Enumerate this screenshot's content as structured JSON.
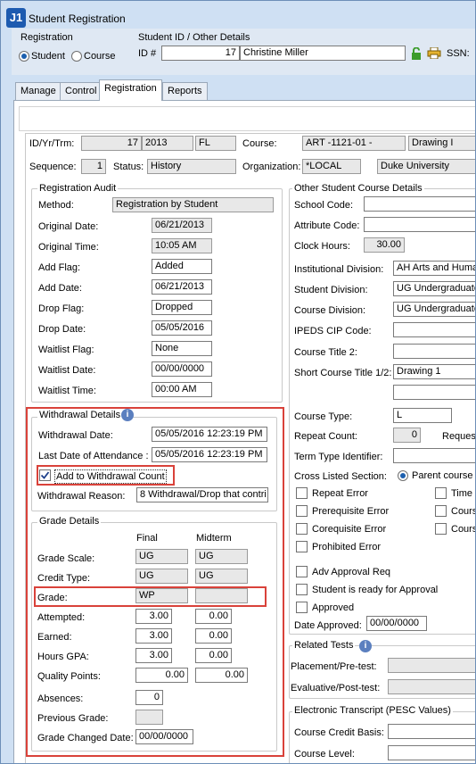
{
  "window": {
    "logo": "J1",
    "title": "Student Registration"
  },
  "header": {
    "registration_label": "Registration",
    "radio_student": "Student",
    "radio_course": "Course",
    "id_group_label": "Student ID / Other Details",
    "id_label": "ID #",
    "id_value": "17",
    "name_value": "Christine Miller",
    "ssn_label": "SSN:"
  },
  "tabs": [
    "Manage",
    "Control",
    "Registration",
    "Reports"
  ],
  "top": {
    "idyrtrm_label": "ID/Yr/Trm:",
    "id": "17",
    "year": "2013",
    "term": "FL",
    "course_label": "Course:",
    "course": "ART -1121-01 -",
    "course_title": "Drawing I",
    "sequence_label": "Sequence:",
    "sequence": "1",
    "status_label": "Status:",
    "status": "History",
    "org_label": "Organization:",
    "org_code": "*LOCAL",
    "org_name": "Duke University"
  },
  "audit": {
    "title": "Registration Audit",
    "method_label": "Method:",
    "method": "Registration by Student",
    "orig_date_label": "Original Date:",
    "orig_date": "06/21/2013",
    "orig_time_label": "Original Time:",
    "orig_time": "10:05 AM",
    "add_flag_label": "Add Flag:",
    "add_flag": "Added",
    "add_date_label": "Add Date:",
    "add_date": "06/21/2013",
    "drop_flag_label": "Drop Flag:",
    "drop_flag": "Dropped",
    "drop_date_label": "Drop Date:",
    "drop_date": "05/05/2016",
    "waitlist_flag_label": "Waitlist Flag:",
    "waitlist_flag": "None",
    "waitlist_date_label": "Waitlist Date:",
    "waitlist_date": "00/00/0000",
    "waitlist_time_label": "Waitlist Time:",
    "waitlist_time": "00:00 AM"
  },
  "withdrawal": {
    "title": "Withdrawal Details",
    "date_label": "Withdrawal Date:",
    "date": "05/05/2016 12:23:19 PM",
    "last_attend_label": "Last Date of Attendance :",
    "last_attend": "05/05/2016 12:23:19 PM",
    "add_count_label": "Add to Withdrawal Count",
    "reason_label": "Withdrawal Reason:",
    "reason": "8  Withdrawal/Drop that contri"
  },
  "grades": {
    "title": "Grade Details",
    "col_final": "Final",
    "col_midterm": "Midterm",
    "scale_label": "Grade Scale:",
    "scale_final": "UG",
    "scale_mid": "UG",
    "credit_label": "Credit Type:",
    "credit_final": "UG",
    "credit_mid": "UG",
    "grade_label": "Grade:",
    "grade_final": "WP",
    "grade_mid": "",
    "attempted_label": "Attempted:",
    "attempted_final": "3.00",
    "attempted_mid": "0.00",
    "earned_label": "Earned:",
    "earned_final": "3.00",
    "earned_mid": "0.00",
    "hours_label": "Hours GPA:",
    "hours_final": "3.00",
    "hours_mid": "0.00",
    "qp_label": "Quality Points:",
    "qp_final": "0.00",
    "qp_mid": "0.00",
    "absences_label": "Absences:",
    "absences": "0",
    "prev_label": "Previous Grade:",
    "prev": "",
    "changed_label": "Grade Changed Date:",
    "changed": "00/00/0000"
  },
  "other": {
    "title": "Other Student Course Details",
    "school_label": "School Code:",
    "attr_label": "Attribute Code:",
    "clock_label": "Clock Hours:",
    "clock": "30.00",
    "inst_div_label": "Institutional Division:",
    "inst_div": "AH   Arts and Huma",
    "stud_div_label": "Student Division:",
    "stud_div": "UG Undergraduate",
    "course_div_label": "Course Division:",
    "course_div": "UG Undergraduate",
    "ipeds_label": "IPEDS CIP Code:",
    "title2_label": "Course Title 2:",
    "short_title_label": "Short Course Title 1/2:",
    "short_title": "Drawing 1",
    "course_type_label": "Course Type:",
    "course_type": "L",
    "repeat_count_label": "Repeat Count:",
    "repeat_count": "0",
    "reques_label": "Reques",
    "term_type_label": "Term Type Identifier:",
    "cross_label": "Cross Listed Section:",
    "parent_course": "Parent course",
    "repeat_error": "Repeat Error",
    "prereq_error": "Prerequisite Error",
    "coreq_error": "Corequisite Error",
    "prohibited_error": "Prohibited Error",
    "time_label": "Time",
    "cours1": "Cours",
    "cours2": "Cours",
    "adv_approval": "Adv Approval Req",
    "ready_approval": "Student is ready for Approval",
    "approved": "Approved",
    "date_approved_label": "Date Approved:",
    "date_approved": "00/00/0000",
    "related_tests": "Related Tests",
    "placement_label": "Placement/Pre-test:",
    "evaluative_label": "Evaluative/Post-test:",
    "etranscript": "Electronic Transcript (PESC Values)",
    "credit_basis_label": "Course Credit Basis:",
    "course_level_label": "Course Level:"
  }
}
